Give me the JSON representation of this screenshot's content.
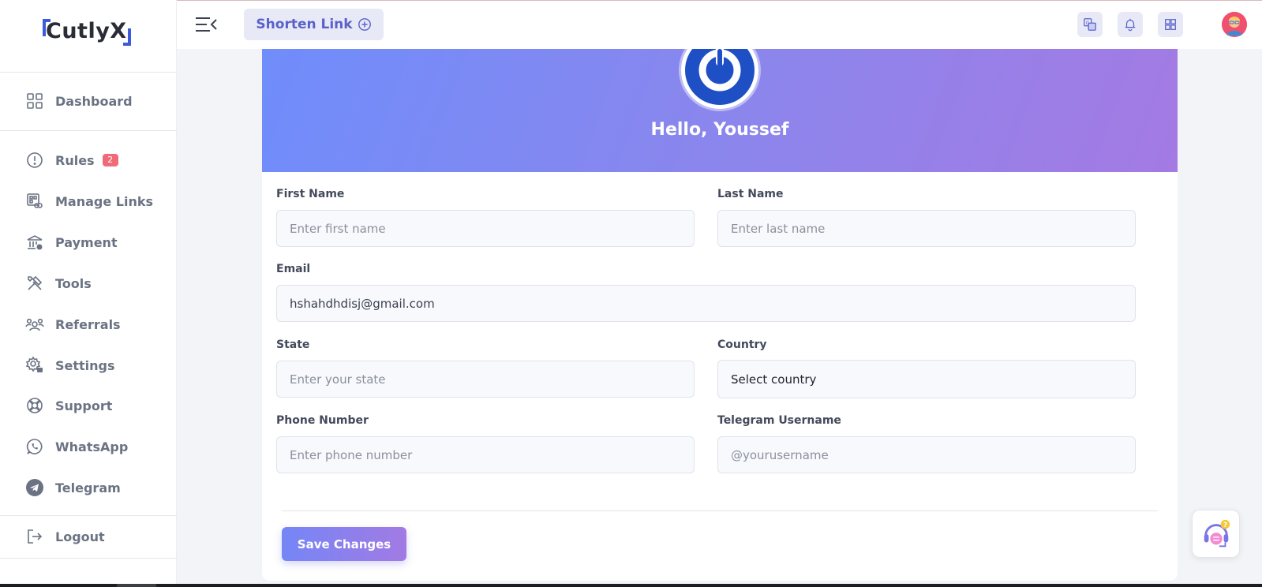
{
  "brand": {
    "name": "CutlyX",
    "accent": "#3b5bdb"
  },
  "sidebar": {
    "items": [
      {
        "label": "Dashboard",
        "icon": "grid-icon"
      },
      {
        "label": "Rules",
        "icon": "alert-circle-icon",
        "badge": "2"
      },
      {
        "label": "Manage Links",
        "icon": "link-manage-icon"
      },
      {
        "label": "Payment",
        "icon": "bank-icon"
      },
      {
        "label": "Tools",
        "icon": "tools-icon"
      },
      {
        "label": "Referrals",
        "icon": "users-icon"
      },
      {
        "label": "Settings",
        "icon": "gear-icon"
      },
      {
        "label": "Support",
        "icon": "lifebuoy-icon"
      },
      {
        "label": "WhatsApp",
        "icon": "whatsapp-icon"
      },
      {
        "label": "Telegram",
        "icon": "telegram-icon"
      }
    ],
    "logout": {
      "label": "Logout",
      "icon": "logout-icon"
    }
  },
  "header": {
    "shorten_label": "Shorten Link",
    "icons": [
      "translate-icon",
      "bell-icon",
      "apps-grid-icon",
      "avatar"
    ]
  },
  "profile": {
    "greeting": "Hello, Youssef"
  },
  "form": {
    "first_name": {
      "label": "First Name",
      "placeholder": "Enter first name",
      "value": ""
    },
    "last_name": {
      "label": "Last Name",
      "placeholder": "Enter last name",
      "value": ""
    },
    "email": {
      "label": "Email",
      "placeholder": "",
      "value": "hshahdhdisj@gmail.com"
    },
    "state": {
      "label": "State",
      "placeholder": "Enter your state",
      "value": ""
    },
    "country": {
      "label": "Country",
      "selected": "Select country"
    },
    "phone": {
      "label": "Phone Number",
      "placeholder": "Enter phone number",
      "value": ""
    },
    "telegram": {
      "label": "Telegram Username",
      "placeholder": "@yourusername",
      "value": ""
    },
    "save_label": "Save Changes"
  },
  "colors": {
    "banner_start": "#6f8dfb",
    "banner_end": "#a47ae3",
    "badge": "#f06a78",
    "nav_text": "#6b7383"
  }
}
